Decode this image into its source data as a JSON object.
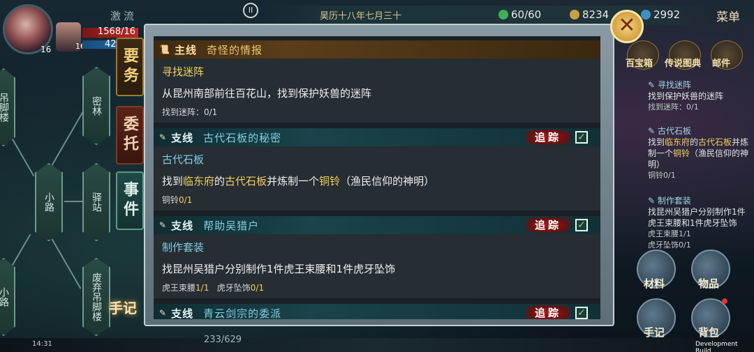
{
  "hud": {
    "location": "激流",
    "player_level": "16",
    "companion_level": "16",
    "hp_text": "1568/16",
    "mp_text": "42",
    "date": "昊历十八年七月三十",
    "stamina": "60/60",
    "coins": "8234",
    "jade": "2992",
    "menu": "菜单",
    "pause_icon": "pause-icon"
  },
  "map": {
    "nodes": [
      "吊脚楼",
      "密林",
      "小路",
      "驿站",
      "小路",
      "废弃吊脚楼"
    ]
  },
  "tabs": {
    "yaowu": "要务",
    "weituo": "委托",
    "shijian": "事件",
    "shouji": "手记"
  },
  "right_menu": {
    "treasure": "百宝箱",
    "legend": "传说图典",
    "mail": "邮件",
    "material": "材料",
    "items": "物品",
    "journal": "手记",
    "bag": "背包"
  },
  "tracker": [
    {
      "title": "寻找迷阵",
      "desc": "找到保护妖兽的迷阵",
      "progress": "找到迷阵：0/1"
    },
    {
      "title": "古代石板",
      "desc_parts": [
        "找到",
        "临东府",
        "的",
        "古代石板",
        "并炼制一个",
        "铜铃",
        "（渔民信仰的神明）"
      ],
      "progress": "铜铃0/1"
    },
    {
      "title": "制作套装",
      "desc": "找昆州吴猎户分别制作1件虎王束腰和1件虎牙坠饰",
      "progress": "虎王束腰1/1",
      "progress2": "虎牙坠饰0/1"
    }
  ],
  "quests": [
    {
      "type": "主线",
      "name": "奇怪的情报",
      "subtitle": "寻找迷阵",
      "desc": "从昆州南部前往百花山，找到保护妖兽的迷阵",
      "progress": "找到迷阵：0/1"
    },
    {
      "type": "支线",
      "name": "古代石板的秘密",
      "track": "追踪",
      "subtitle": "古代石板",
      "desc_a": "找到",
      "desc_b": "临东府",
      "desc_c": "的",
      "desc_d": "古代石板",
      "desc_e": "并炼制一个",
      "desc_f": "铜铃",
      "desc_g": "（渔民信仰的神明）",
      "progress_label": "铜铃",
      "progress_value": "0/1"
    },
    {
      "type": "支线",
      "name": "帮助吴猎户",
      "track": "追踪",
      "subtitle": "制作套装",
      "desc": "找昆州吴猎户分别制作1件虎王束腰和1件虎牙坠饰",
      "p1_label": "虎王束腰",
      "p1_value": "1/1",
      "p2_label": "虎牙坠饰",
      "p2_value": "0/1"
    },
    {
      "type": "支线",
      "name": "青云剑宗的委派",
      "track": "追踪"
    }
  ],
  "status": {
    "time": "14:31",
    "count": "233/629",
    "dev_build": "Development Build"
  }
}
